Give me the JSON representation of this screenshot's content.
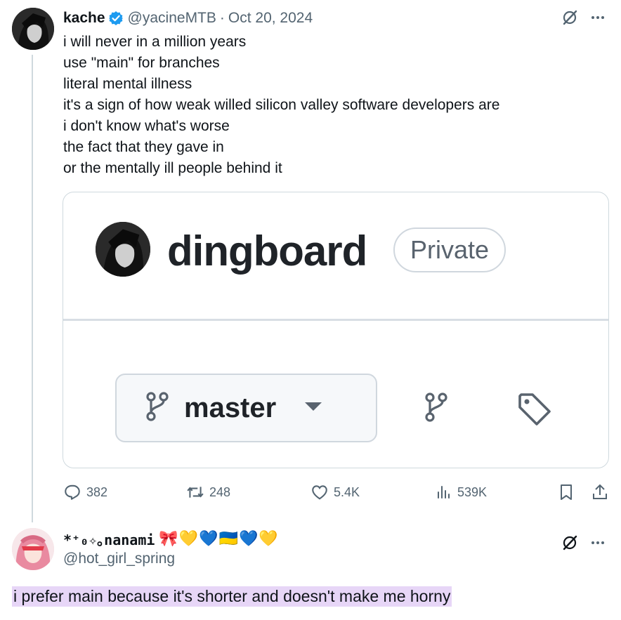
{
  "tweet": {
    "display_name": "kache",
    "handle": "@yacineMTB",
    "separator": "·",
    "date": "Oct 20, 2024",
    "verified_color": "#1d9bf0",
    "lines": [
      "i will never in a million years",
      "use \"main\" for branches",
      "literal mental illness",
      "it's a sign of how weak willed silicon valley software developers are",
      "i don't know what's worse",
      "the fact that they gave in",
      "or the mentally ill people behind it"
    ],
    "card": {
      "repo_name": "dingboard",
      "visibility_badge": "Private",
      "branch_name": "master",
      "icons": [
        "git-branch-icon",
        "caret-down-icon",
        "git-branch-icon",
        "tag-icon"
      ]
    },
    "stats": {
      "replies": "382",
      "reposts": "248",
      "likes": "5.4K",
      "views": "539K"
    }
  },
  "reply": {
    "display_name": "*⁺₀✧｡nanami",
    "emoji": "🎀💛💙🇺🇦💙💛",
    "handle": "@hot_girl_spring",
    "text": "i prefer main because it's shorter and doesn't make me horny",
    "highlight_color": "#e7d6f7"
  },
  "icons": {
    "grok": "grok-icon",
    "more": "more-icon",
    "reply": "reply-icon",
    "repost": "repost-icon",
    "like": "heart-icon",
    "views": "views-icon",
    "bookmark": "bookmark-icon",
    "share": "share-icon"
  }
}
